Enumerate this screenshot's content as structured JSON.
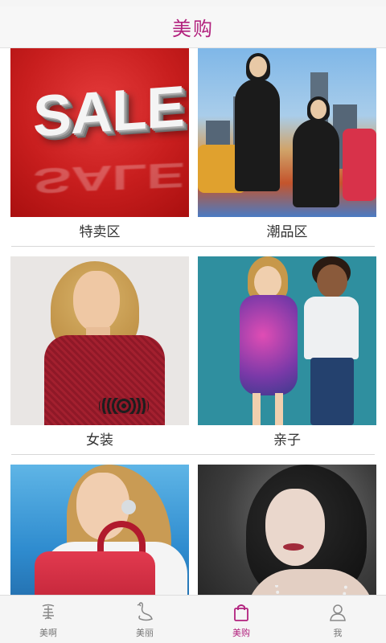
{
  "header": {
    "title": "美购"
  },
  "categories": [
    {
      "label": "特卖区",
      "image": "sale-promo-image",
      "image_text": "SALE"
    },
    {
      "label": "潮品区",
      "image": "trendy-fashion-image"
    },
    {
      "label": "女装",
      "image": "women-clothing-image"
    },
    {
      "label": "亲子",
      "image": "kids-family-image"
    },
    {
      "label": "",
      "image": "handbag-accessories-image"
    },
    {
      "label": "",
      "image": "glamour-jewelry-image"
    }
  ],
  "tabs": [
    {
      "label": "美啊",
      "icon": "mei-logo-icon",
      "active": false
    },
    {
      "label": "美丽",
      "icon": "swan-icon",
      "active": false
    },
    {
      "label": "美购",
      "icon": "shopping-bag-icon",
      "active": true
    },
    {
      "label": "我",
      "icon": "person-icon",
      "active": false
    }
  ],
  "colors": {
    "accent": "#b2227e",
    "tab_inactive": "#777777",
    "header_bg": "#f7f7f7"
  }
}
